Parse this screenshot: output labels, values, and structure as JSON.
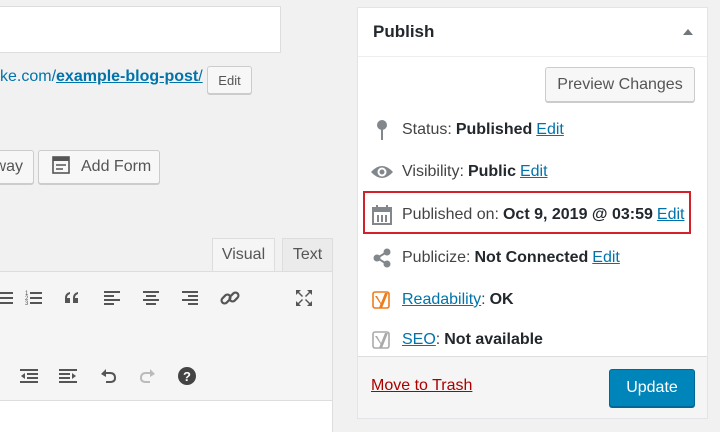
{
  "permalink": {
    "url_prefix": "ke.com/",
    "slug": "example-blog-post",
    "url_suffix": "/",
    "edit_label": "Edit"
  },
  "media_buttons": {
    "giveaway_label": "way",
    "add_form_label": "Add Form"
  },
  "editor_tabs": {
    "visual": "Visual",
    "text": "Text",
    "active": "Visual"
  },
  "toolbar": {
    "row1": [
      "bulleted-list-icon",
      "numbered-list-icon",
      "blockquote-icon",
      "align-left-icon",
      "align-center-icon",
      "align-right-icon",
      "link-icon",
      "fullscreen-icon"
    ],
    "row2": [
      "outdent-icon",
      "indent-icon",
      "undo-icon",
      "redo-icon",
      "help-icon"
    ]
  },
  "publish": {
    "title": "Publish",
    "preview_label": "Preview Changes",
    "status_label": "Status:",
    "status_value": "Published",
    "visibility_label": "Visibility:",
    "visibility_value": "Public",
    "published_label": "Published on:",
    "published_value": "Oct 9, 2019 @ 03:59",
    "publicize_label": "Publicize:",
    "publicize_value": "Not Connected",
    "edit_link": "Edit",
    "readability_link": "Readability",
    "readability_value": "OK",
    "seo_link": "SEO",
    "seo_value": "Not available",
    "trash_label": "Move to Trash",
    "update_label": "Update"
  },
  "colors": {
    "link": "#0073aa",
    "primary_button": "#0085ba",
    "trash": "#a00",
    "highlight": "#d22128",
    "yoast_ok": "#ee7c1b"
  }
}
